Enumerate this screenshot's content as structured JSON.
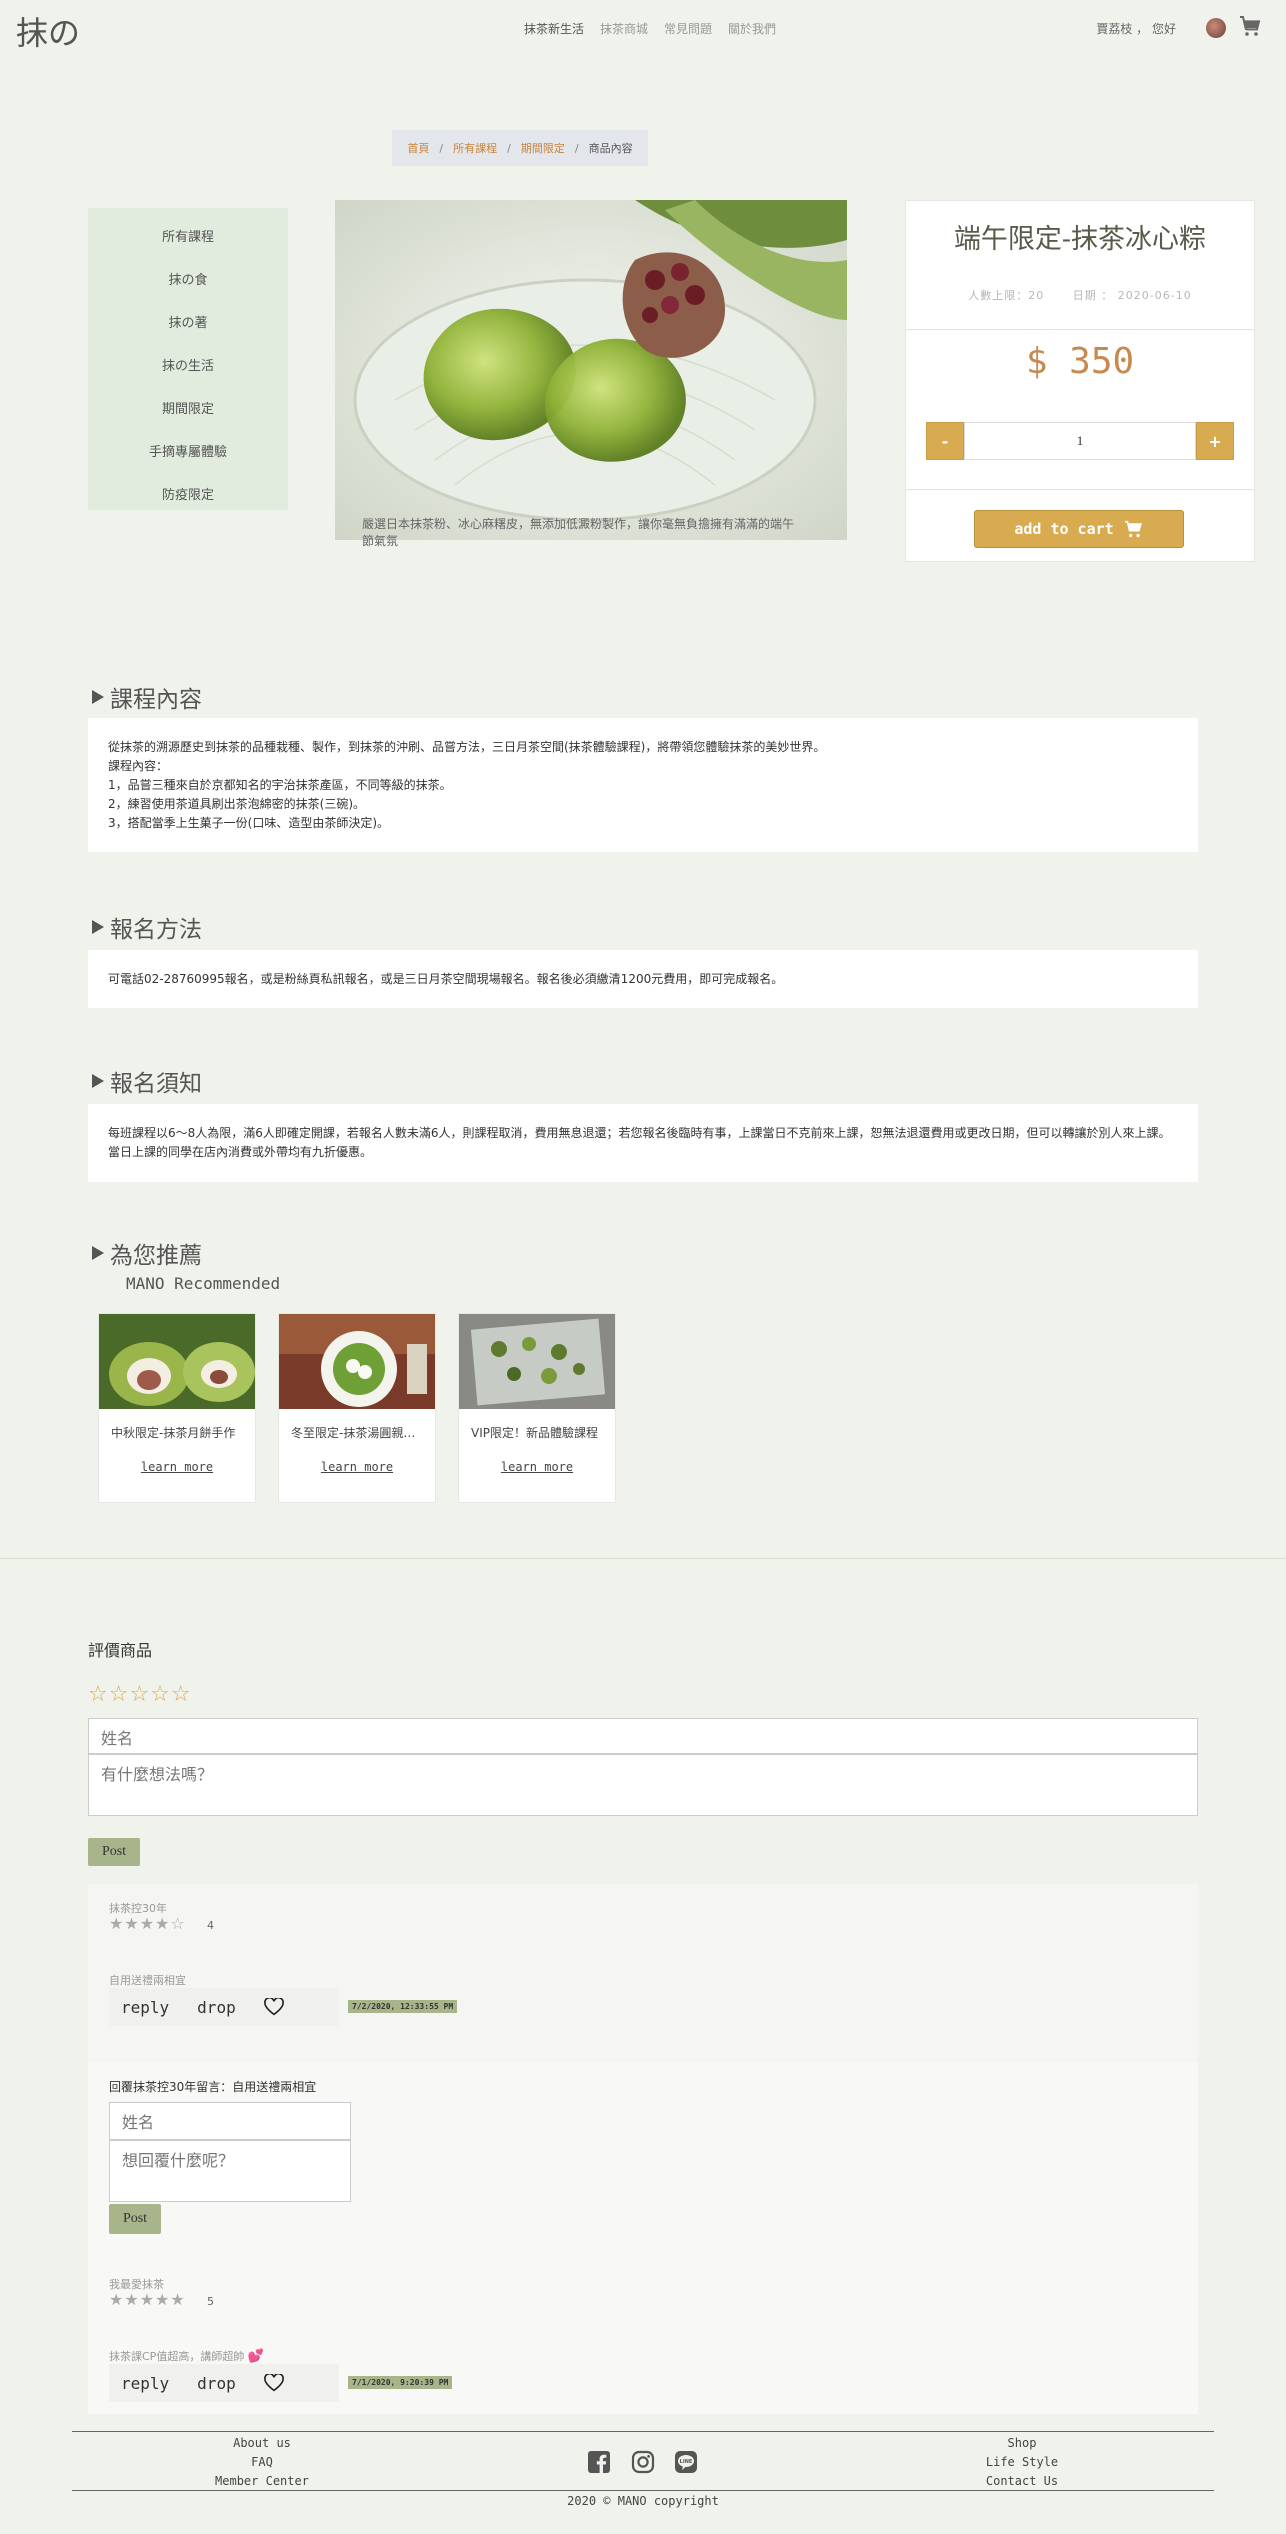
{
  "header": {
    "logo": "抹の",
    "nav": [
      "抹茶新生活",
      "抹茶商城",
      "常見問題",
      "關於我們"
    ],
    "greeting": "賈荔枝 ， 您好"
  },
  "breadcrumb": [
    "首頁",
    "所有課程",
    "期間限定",
    "商品內容"
  ],
  "sidebar": [
    "所有課程",
    "抹の食",
    "抹の著",
    "抹の生活",
    "期間限定",
    "手摘專屬體驗",
    "防疫限定"
  ],
  "product": {
    "caption": "嚴選日本抹茶粉、冰心麻糬皮，無添加低澱粉製作，讓你毫無負擔擁有滿滿的端午節氣氛",
    "title": "端午限定-抹茶冰心粽",
    "capacity": "人數上限：20",
    "date": "日期 ： 2020-06-10",
    "price": "$ 350",
    "qty_minus": "-",
    "qty": "1",
    "qty_plus": "+",
    "add_to_cart": "add to cart"
  },
  "sections": {
    "content_title": "課程內容",
    "content_text": "從抹茶的溯源歷史到抹茶的品種栽種、製作，到抹茶的沖刷、品嘗方法，三日月茶空間(抹茶體驗課程)，將帶領您體驗抹茶的美妙世界。\n課程內容：\n1，品嘗三種來自於京都知名的宇治抹茶產區，不同等級的抹茶。\n2，練習使用茶道具刷出茶泡綿密的抹茶(三碗)。\n3，搭配當季上生菓子一份(口味、造型由茶師決定)。",
    "signup_title": "報名方法",
    "signup_text": "可電話02-28760995報名，或是粉絲頁私訊報名，或是三日月茶空間現場報名。報名後必須繳清1200元費用，即可完成報名。",
    "notice_title": "報名須知",
    "notice_text": "每班課程以6～8人為限，滿6人即確定開課，若報名人數未滿6人，則課程取消，費用無息退還；若您報名後臨時有事，上課當日不克前來上課，恕無法退還費用或更改日期，但可以轉讓於別人來上課。當日上課的同學在店內消費或外帶均有九折優惠。",
    "rec_title": "為您推薦",
    "rec_sub": "MANO Recommended"
  },
  "recommend": [
    {
      "title": "中秋限定-抹茶月餅手作",
      "more": "learn more"
    },
    {
      "title": "冬至限定-抹茶湯圓親子手作",
      "more": "learn more"
    },
    {
      "title": "VIP限定！新品體驗課程",
      "more": "learn more"
    }
  ],
  "review_form": {
    "heading": "評價商品",
    "stars": "☆☆☆☆☆",
    "name_placeholder": "姓名",
    "comment_placeholder": "有什麼想法嗎？",
    "post": "Post"
  },
  "reviews": [
    {
      "user": "抹茶控30年",
      "stars": "★★★★☆",
      "score": "4",
      "text": "自用送禮兩相宜",
      "reply": "reply",
      "drop": "drop",
      "time": "7/2/2020, 12:33:55 PM"
    },
    {
      "user": "我最愛抹茶",
      "stars": "★★★★★",
      "score": "5",
      "text": "抹茶課CP值超高，講師超帥",
      "reply": "reply",
      "drop": "drop",
      "time": "7/1/2020, 9:20:39 PM"
    }
  ],
  "reply_form": {
    "to": "回覆抹茶控30年留言：自用送禮兩相宜",
    "name_placeholder": "姓名",
    "reply_placeholder": "想回覆什麼呢？",
    "post": "Post"
  },
  "footer": {
    "left": [
      "About us",
      "FAQ",
      "Member Center"
    ],
    "right": [
      "Shop",
      "Life Style",
      "Contact Us"
    ],
    "copyright": "2020 © MANO copyright"
  },
  "colors": {
    "accent": "#d8ab50",
    "price": "#c8894e",
    "sage": "#a8b58a",
    "bg": "#f0f2ec"
  }
}
